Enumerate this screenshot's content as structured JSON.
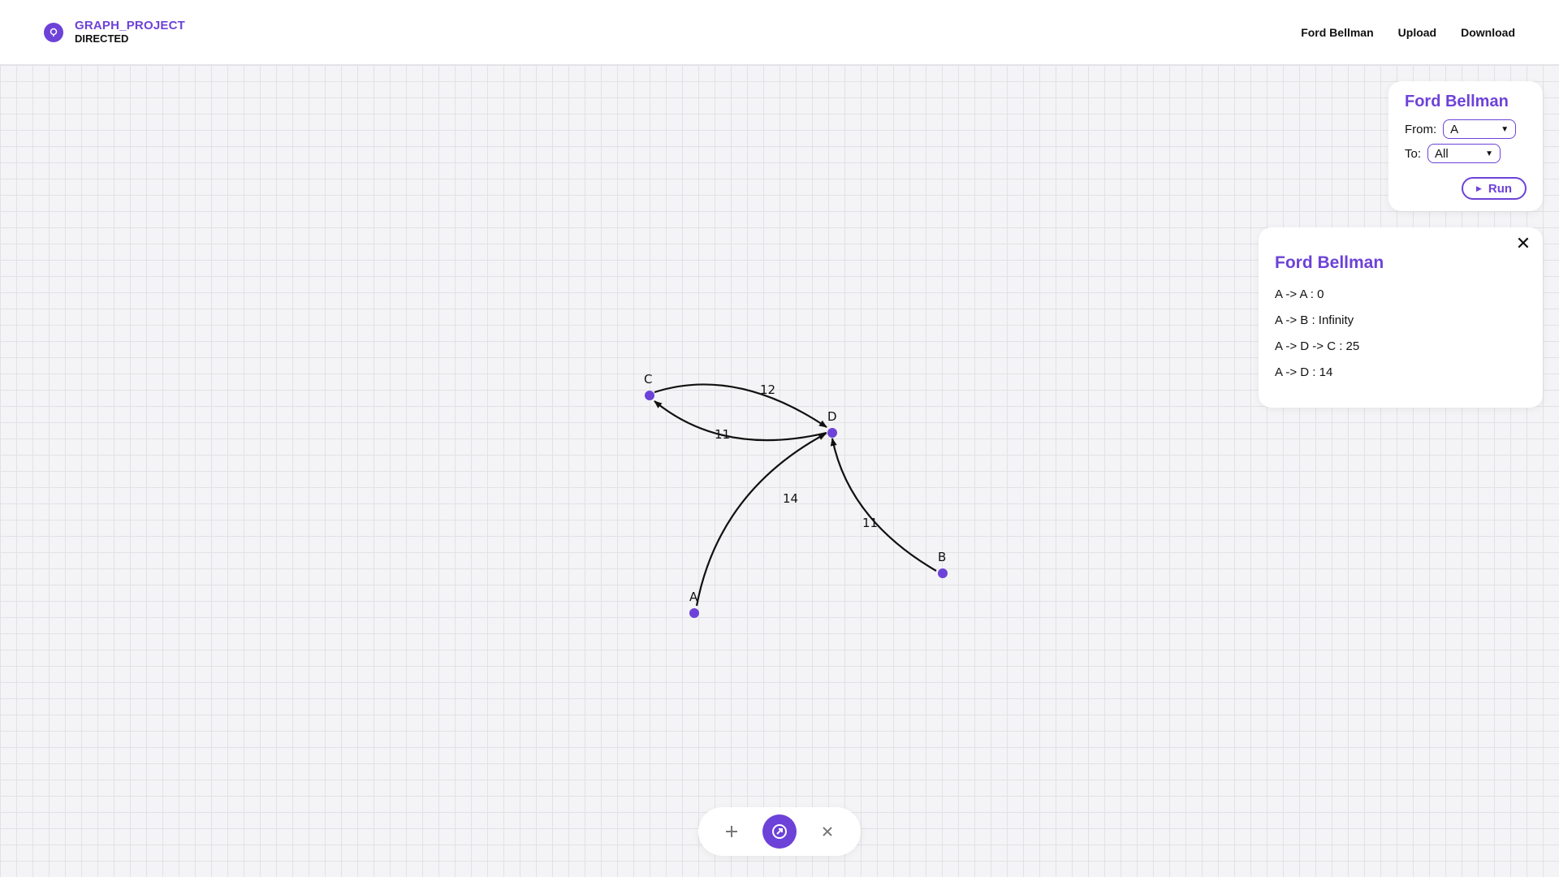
{
  "app": {
    "title": "GRAPH_PROJECT",
    "mode": "DIRECTED",
    "accent": "#6d42d8"
  },
  "nav": {
    "items": [
      "Ford Bellman",
      "Upload",
      "Download"
    ]
  },
  "control_panel": {
    "title": "Ford Bellman",
    "from_label": "From:",
    "from_value": "A",
    "to_label": "To:",
    "to_value": "All",
    "run_label": "Run",
    "run_icon": "play-icon"
  },
  "result_panel": {
    "title": "Ford Bellman",
    "close_icon": "close-icon",
    "results": [
      "A -> A : 0",
      "A -> B : Infinity",
      "A -> D -> C : 25",
      "A -> D : 14"
    ]
  },
  "graph": {
    "nodes": [
      "C",
      "D",
      "A",
      "B"
    ],
    "edges": [
      {
        "from": "C",
        "to": "D",
        "weight": "12"
      },
      {
        "from": "D",
        "to": "C",
        "weight": "11"
      },
      {
        "from": "A",
        "to": "D",
        "weight": "14"
      },
      {
        "from": "B",
        "to": "D",
        "weight": "11"
      }
    ]
  },
  "toolbar": {
    "tools": [
      "plus-icon",
      "arrow-icon",
      "close-icon"
    ],
    "active": "arrow-icon"
  }
}
